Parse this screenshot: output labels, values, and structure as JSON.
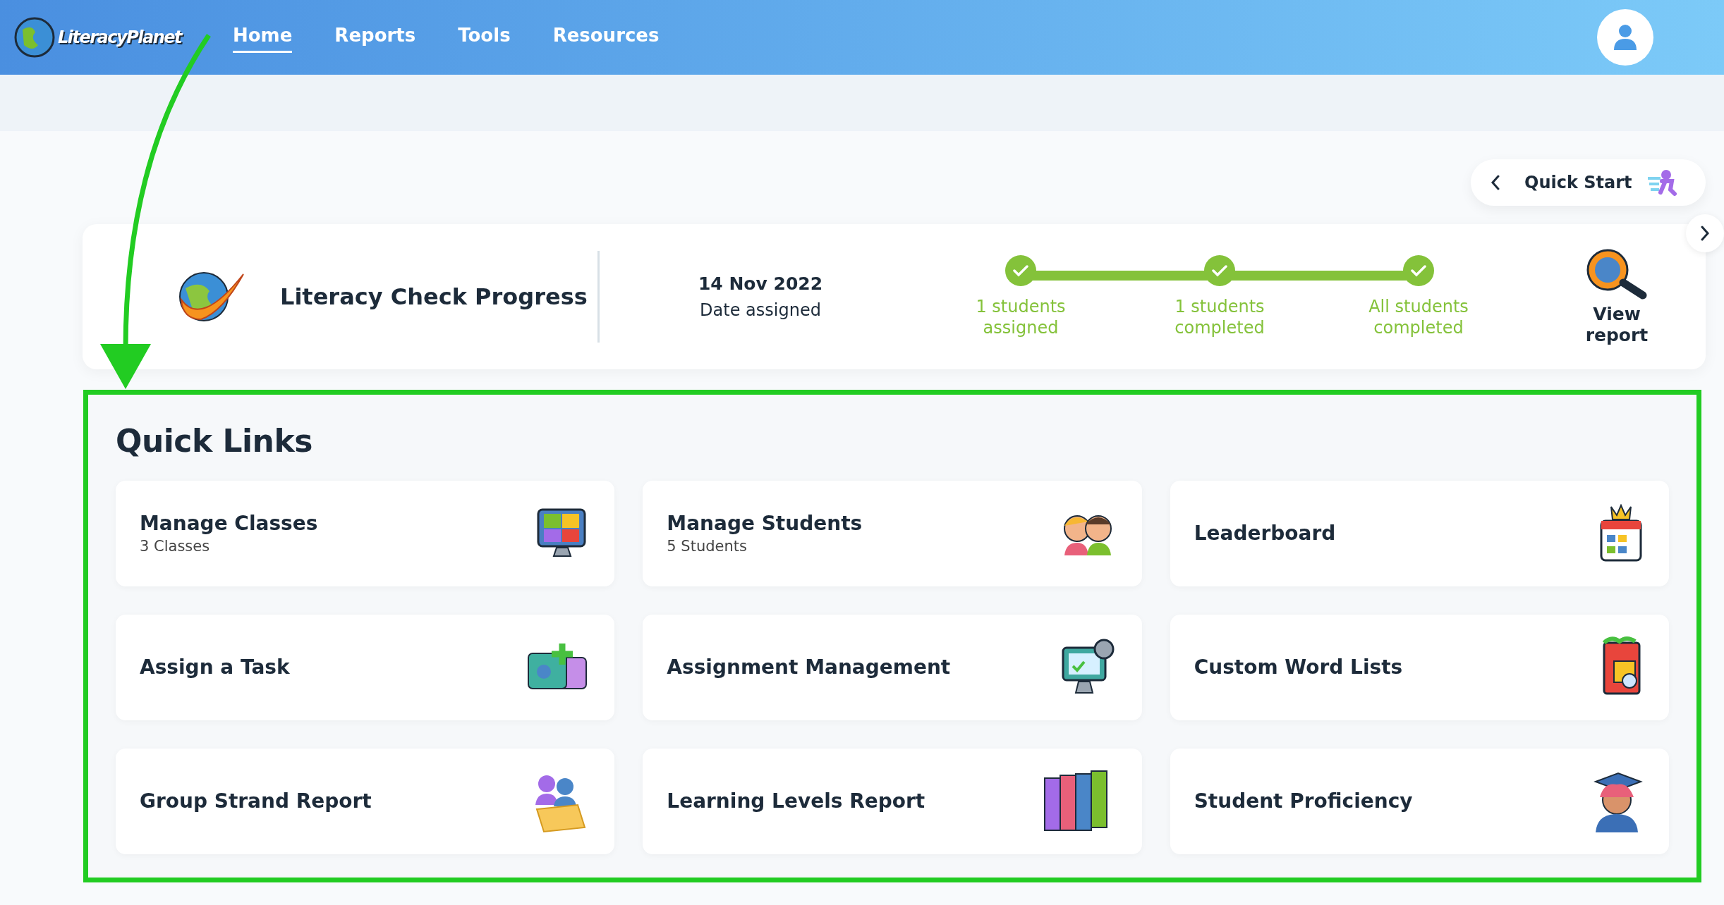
{
  "header": {
    "logo": "LiteracyPlanet",
    "nav": [
      {
        "label": "Home",
        "selected": true
      },
      {
        "label": "Reports",
        "selected": false
      },
      {
        "label": "Tools",
        "selected": false
      },
      {
        "label": "Resources",
        "selected": false
      }
    ]
  },
  "quick_start": {
    "label": "Quick Start"
  },
  "progress": {
    "title": "Literacy Check Progress",
    "date": "14 Nov 2022",
    "date_label": "Date assigned",
    "steps": [
      {
        "label": "1 students assigned",
        "done": true
      },
      {
        "label": "1 students completed",
        "done": true
      },
      {
        "label": "All students completed",
        "done": true
      }
    ],
    "view_report": "View report"
  },
  "quick_links": {
    "title": "Quick Links",
    "items": [
      {
        "kind": "classes",
        "title": "Manage Classes",
        "subtitle": "3 Classes"
      },
      {
        "kind": "students",
        "title": "Manage Students",
        "subtitle": "5 Students"
      },
      {
        "kind": "leaderboard",
        "title": "Leaderboard"
      },
      {
        "kind": "assign",
        "title": "Assign a Task"
      },
      {
        "kind": "assignments",
        "title": "Assignment Management"
      },
      {
        "kind": "wordlists",
        "title": "Custom Word Lists"
      },
      {
        "kind": "strand",
        "title": "Group Strand Report"
      },
      {
        "kind": "levels",
        "title": "Learning Levels Report"
      },
      {
        "kind": "proficiency",
        "title": "Student Proficiency"
      }
    ]
  }
}
